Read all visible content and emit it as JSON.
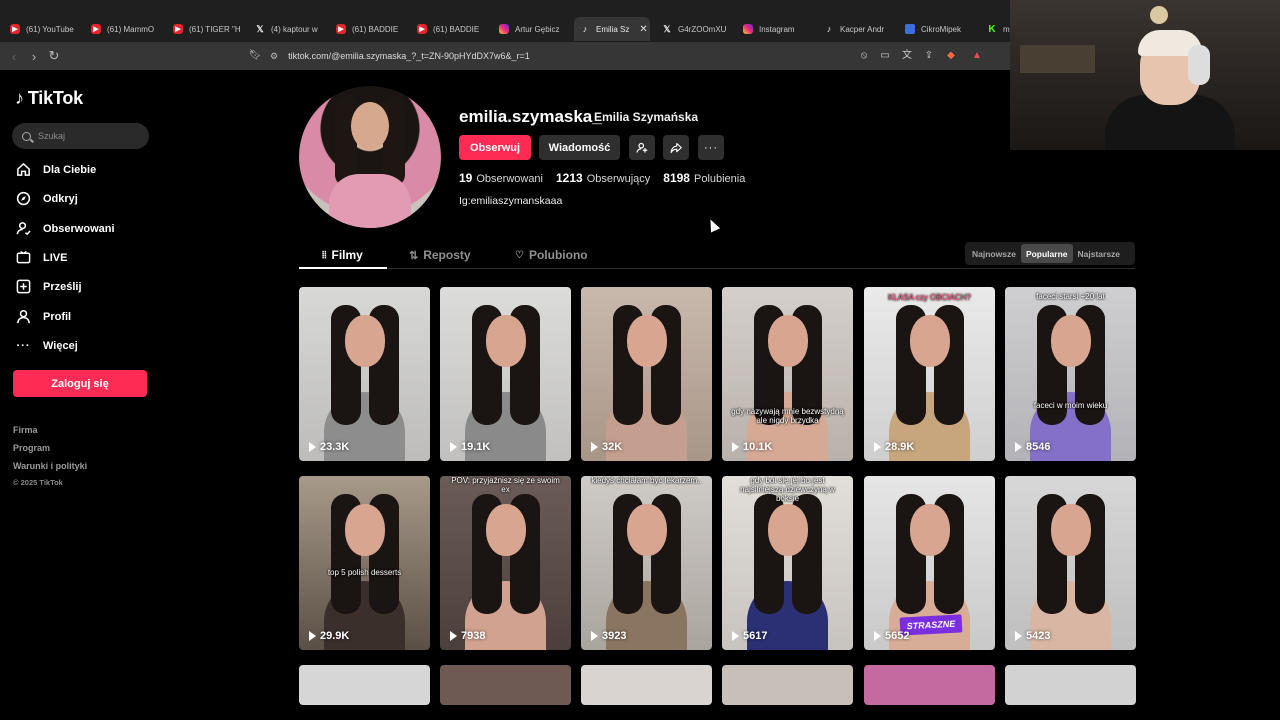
{
  "browser": {
    "tabs": [
      {
        "label": "(61) YouTube",
        "icon": "youtube-icon"
      },
      {
        "label": "(61) MammO",
        "icon": "youtube-icon"
      },
      {
        "label": "(61) TIGER \"H",
        "icon": "youtube-icon"
      },
      {
        "label": "(4) kaptour w",
        "icon": "x-icon"
      },
      {
        "label": "(61) BADDIE",
        "icon": "youtube-icon"
      },
      {
        "label": "(61) BADDIE",
        "icon": "youtube-icon"
      },
      {
        "label": "Artur Gębicz",
        "icon": "instagram-icon"
      },
      {
        "label": "Emilia Sz",
        "icon": "tiktok-icon",
        "active": true
      },
      {
        "label": "G4rZOOmXU",
        "icon": "x-icon"
      },
      {
        "label": "Instagram",
        "icon": "instagram-icon"
      },
      {
        "label": "Kacper Andr",
        "icon": "tiktok-icon"
      },
      {
        "label": "CikroMipek",
        "icon": "cikromipek-icon"
      },
      {
        "label": "m",
        "icon": "kick-icon"
      }
    ],
    "url": "tiktok.com/@emilia.szymaska_?_t=ZN-90pHYdDX7w6&_r=1"
  },
  "sidebar": {
    "logo": "TikTok",
    "search_placeholder": "Szukaj",
    "nav": [
      {
        "label": "Dla Ciebie",
        "icon": "home-icon"
      },
      {
        "label": "Odkryj",
        "icon": "compass-icon"
      },
      {
        "label": "Obserwowani",
        "icon": "following-icon"
      },
      {
        "label": "LIVE",
        "icon": "live-icon"
      },
      {
        "label": "Prześlij",
        "icon": "upload-icon"
      },
      {
        "label": "Profil",
        "icon": "profile-icon"
      },
      {
        "label": "Więcej",
        "icon": "more-icon"
      }
    ],
    "login_label": "Zaloguj się",
    "footer": [
      "Firma",
      "Program",
      "Warunki i polityki"
    ],
    "copyright": "© 2025 TikTok"
  },
  "profile": {
    "username": "emilia.szymaska_",
    "display_name": "Emilia Szymańska",
    "follow_label": "Obserwuj",
    "message_label": "Wiadomość",
    "stats": {
      "following_count": "19",
      "following_label": "Obserwowani",
      "followers_count": "1213",
      "followers_label": "Obserwujący",
      "likes_count": "8198",
      "likes_label": "Polubienia"
    },
    "bio": "Ig:emiliaszymanskaaa"
  },
  "content_tabs": [
    {
      "label": "Filmy",
      "active": true
    },
    {
      "label": "Reposty"
    },
    {
      "label": "Polubiono"
    }
  ],
  "sort": [
    {
      "label": "Najnowsze"
    },
    {
      "label": "Popularne",
      "active": true
    },
    {
      "label": "Najstarsze"
    }
  ],
  "videos": [
    {
      "views": "23.3K",
      "overlay": ""
    },
    {
      "views": "19.1K",
      "overlay": ""
    },
    {
      "views": "32K",
      "overlay": ""
    },
    {
      "views": "10.1K",
      "overlay": "gdy nazywają mnie bezwstydną ale nigdy brzydka"
    },
    {
      "views": "28.9K",
      "overlay": "KLASA czy OBCIACH?"
    },
    {
      "views": "8546",
      "overlay": "faceci starsi +20 lat",
      "overlay2": "faceci w moim wieku"
    },
    {
      "views": "29.9K",
      "overlay": "top 5 polish desserts"
    },
    {
      "views": "7938",
      "overlay": "POV: przyjaźnisz się ze swoim ex"
    },
    {
      "views": "3923",
      "overlay": "kiedyś chciałam być lekarzem.."
    },
    {
      "views": "5617",
      "overlay": "gdy boi się jej bo jest najsilniejszą dziewczyną w boksie"
    },
    {
      "views": "5652",
      "overlay": "",
      "sticker": "STRASZNE"
    },
    {
      "views": "5423",
      "overlay": ""
    }
  ],
  "colors": {
    "accent": "#fe2c55",
    "background": "#000000"
  }
}
